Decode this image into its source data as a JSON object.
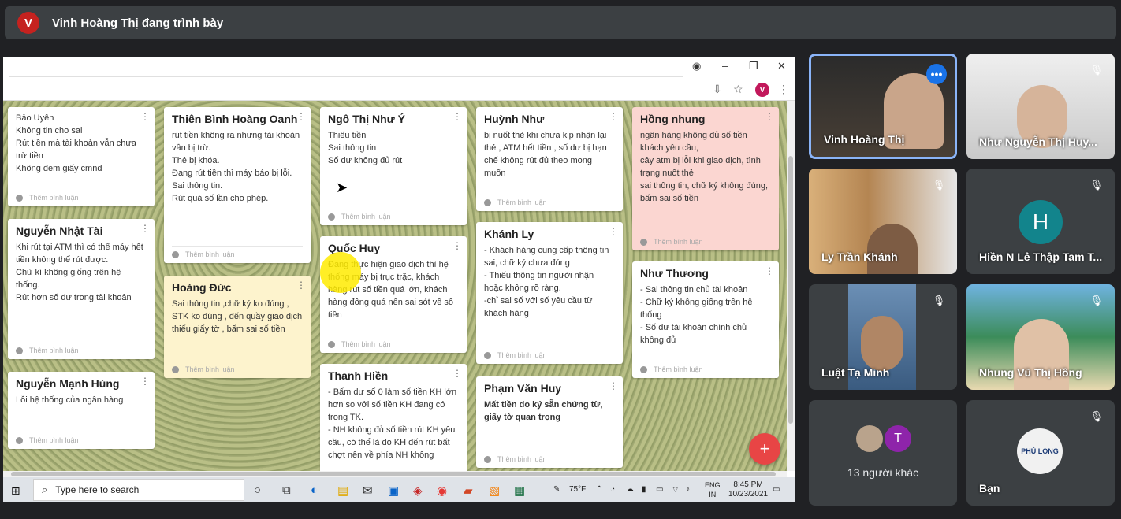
{
  "banner": {
    "initial": "V",
    "title": "Vinh Hoàng Thị đang trình bày"
  },
  "browser": {
    "profile_initial": "V"
  },
  "cards": {
    "c1": {
      "title": "",
      "body": "Bảo Uyên\nKhông tin cho sai\nRút tiền mà tài khoản vẫn chưa trừ tiền\nKhông đem giấy cmnd",
      "comment": "Thêm bình luận"
    },
    "c2": {
      "title": "Thiên Bình Hoàng Oanh",
      "body": "rút tiền không ra nhưng tài khoản vẫn bị trừ.\nThẻ bị khóa.\nĐang rút tiền thì máy báo bị lỗi.\nSai thông tin.\nRút quá số lần cho phép.",
      "comment": "Thêm bình luận"
    },
    "c3": {
      "title": "Ngô Thị Như Ý",
      "body": "Thiếu tiền\nSai thông tin\nSố dư không đủ rút",
      "comment": "Thêm bình luận"
    },
    "c4": {
      "title": "Huỳnh Như",
      "body": "bị nuốt thẻ khi chưa kịp nhận lại thẻ , ATM hết tiền , số dư bị hạn chế không rút đủ theo mong muốn",
      "comment": "Thêm bình luận"
    },
    "c5": {
      "title": "Hồng nhung",
      "body": "ngân hàng không đủ số tiền khách yêu cầu,\ncây atm bị lỗi khi giao dịch, tình trạng nuốt thẻ\nsai thông tin, chữ ký không đúng, bấm sai số tiền",
      "comment": "Thêm bình luận"
    },
    "c6": {
      "title": "Nguyễn Nhật Tài",
      "body": "Khi rút tại ATM thì có thể máy hết tiền không thể rút được.\nChữ kí không giống trên hệ thống.\nRút hơn số dư trong tài khoản",
      "comment": "Thêm bình luận"
    },
    "c7": {
      "title": "Hoàng Đức",
      "body": "Sai thông tin ,chữ ký ko đúng , STK ko đúng , đến quầy giao dịch thiếu giấy tờ , bấm sai số tiền",
      "comment": "Thêm bình luận"
    },
    "c8": {
      "title": "Quốc Huy",
      "body": "Đang thực hiện giao dịch thì hệ thống máy bị trục trặc, khách hàng rút số tiền quá lớn, khách hàng đông quá nên sai sót về số tiền",
      "comment": "Thêm bình luận"
    },
    "c9": {
      "title": "Khánh Ly",
      "body": "- Khách hàng cung cấp thông tin sai, chữ ký chưa đúng\n- Thiếu thông tin người nhận hoặc không rõ ràng.\n-chỉ sai số với số yêu cầu từ khách hàng",
      "comment": "Thêm bình luận"
    },
    "c10": {
      "title": "Như Thương",
      "body": "- Sai thông tin chủ tài khoản\n- Chữ ký không giống trên hệ thống\n- Số dư tài khoản chính chủ không đủ",
      "comment": "Thêm bình luận"
    },
    "c11": {
      "title": "Nguyễn Mạnh Hùng",
      "body": "Lỗi hệ thống của ngân hàng",
      "comment": "Thêm bình luận"
    },
    "c12": {
      "title": "Thanh Hiền",
      "body": "- Bấm dư số 0 làm số tiền KH lớn hơn so với số tiền KH đang có trong TK.\n- NH không đủ số tiền rút KH yêu cầu, có thể là do KH đến rút bất chợt nên về phía NH không",
      "comment": ""
    },
    "c13": {
      "title": "Phạm Văn Huy",
      "body": "Mất tiền do ký sẵn chứng từ, giấy tờ quan trọng",
      "comment": "Thêm bình luận"
    }
  },
  "fab": {
    "label": "+"
  },
  "taskbar": {
    "search_placeholder": "Type here to search",
    "temp": "75°F",
    "lang1": "ENG",
    "lang2": "IN",
    "time": "8:45 PM",
    "date": "10/23/2021"
  },
  "participants": {
    "p1": {
      "name": "Vinh Hoàng Thị"
    },
    "p2": {
      "name": "Như Nguyễn Thị Huy..."
    },
    "p3": {
      "name": "Ly Trần Khánh"
    },
    "p4": {
      "name": "Hiền N Lê Thập Tam T...",
      "initial": "H"
    },
    "p5": {
      "name": "Luật Tạ Minh"
    },
    "p6": {
      "name": "Nhung Vũ Thị Hồng"
    },
    "p7": {
      "count": "13 người khác",
      "initial": "T"
    },
    "p8": {
      "name": "Bạn",
      "logo_text": "PHÚ LONG"
    }
  },
  "colors": {
    "accent": "#1a73e8",
    "fab": "#e84545",
    "active_border": "#8ab4f8",
    "tile_bg": "#3c4043"
  }
}
